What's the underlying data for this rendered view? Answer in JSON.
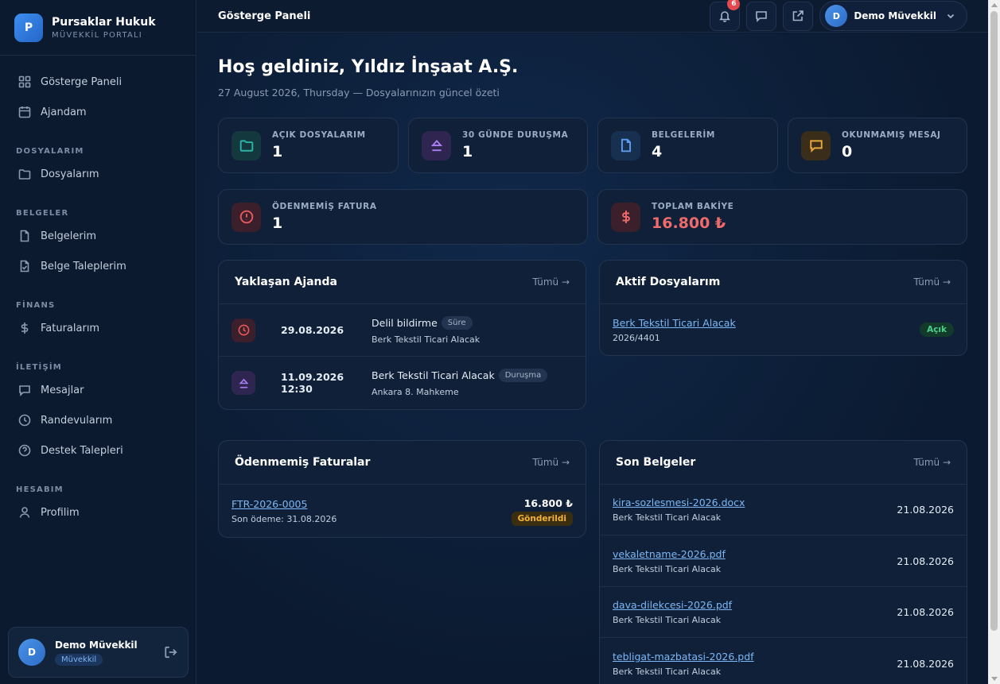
{
  "brand": {
    "logo_letter": "P",
    "name": "Pursaklar Hukuk",
    "subtitle": "MÜVEKKİL PORTALI"
  },
  "sidebar": {
    "items": [
      {
        "label": "Gösterge Paneli",
        "icon": "grid-icon"
      },
      {
        "label": "Ajandam",
        "icon": "calendar-icon"
      }
    ],
    "sections": [
      {
        "title": "DOSYALARIM",
        "items": [
          {
            "label": "Dosyalarım",
            "icon": "folder-icon"
          }
        ]
      },
      {
        "title": "BELGELER",
        "items": [
          {
            "label": "Belgelerim",
            "icon": "file-icon"
          },
          {
            "label": "Belge Taleplerim",
            "icon": "file-check-icon"
          }
        ]
      },
      {
        "title": "FİNANS",
        "items": [
          {
            "label": "Faturalarım",
            "icon": "dollar-icon"
          }
        ]
      },
      {
        "title": "İLETİŞİM",
        "items": [
          {
            "label": "Mesajlar",
            "icon": "message-icon"
          },
          {
            "label": "Randevularım",
            "icon": "clock-icon"
          },
          {
            "label": "Destek Talepleri",
            "icon": "help-icon"
          }
        ]
      },
      {
        "title": "HESABIM",
        "items": [
          {
            "label": "Profilim",
            "icon": "user-icon"
          }
        ]
      }
    ],
    "user": {
      "initial": "D",
      "name": "Demo Müvekkil",
      "role": "Müvekkil"
    }
  },
  "topbar": {
    "title": "Gösterge Paneli",
    "notification_count": "6",
    "user_initial": "D",
    "user_name": "Demo Müvekkil"
  },
  "welcome": {
    "title": "Hoş geldiniz, Yıldız İnşaat A.Ş.",
    "subtitle": "27 August 2026, Thursday — Dosyalarınızın güncel özeti"
  },
  "stats": [
    {
      "label": "AÇIK DOSYALARIM",
      "value": "1",
      "color": "#2bb3a6"
    },
    {
      "label": "30 GÜNDE DURUŞMA",
      "value": "1",
      "color": "#a77ef0"
    },
    {
      "label": "BELGELERİM",
      "value": "4",
      "color": "#5b9cf0"
    },
    {
      "label": "OKUNMAMIŞ MESAJ",
      "value": "0",
      "color": "#e8a93a"
    },
    {
      "label": "ÖDENMEMİŞ FATURA",
      "value": "1",
      "color": "#e55a5a"
    },
    {
      "label": "TOPLAM BAKİYE",
      "value": "16.800 ₺",
      "color": "#ef6b6b"
    }
  ],
  "agenda": {
    "title": "Yaklaşan Ajanda",
    "link": "Tümü →",
    "items": [
      {
        "date": "29.08.2026",
        "title": "Delil bildirme",
        "tag": "Süre",
        "sub": "Berk Tekstil Ticari Alacak"
      },
      {
        "date": "11.09.2026 12:30",
        "title": "Berk Tekstil Ticari Alacak",
        "tag": "Duruşma",
        "sub": "Ankara 8. Mahkeme"
      }
    ]
  },
  "active_files": {
    "title": "Aktif Dosyalarım",
    "link": "Tümü →",
    "items": [
      {
        "name": "Berk Tekstil Ticari Alacak",
        "number": "2026/4401",
        "status": "Açık"
      }
    ]
  },
  "invoices": {
    "title": "Ödenmemiş Faturalar",
    "link": "Tümü →",
    "items": [
      {
        "number": "FTR-2026-0005",
        "due": "Son ödeme: 31.08.2026",
        "amount": "16.800 ₺",
        "status": "Gönderildi"
      }
    ]
  },
  "documents": {
    "title": "Son Belgeler",
    "link": "Tümü →",
    "items": [
      {
        "name": "kira-sozlesmesi-2026.docx",
        "case": "Berk Tekstil Ticari Alacak",
        "date": "21.08.2026"
      },
      {
        "name": "vekaletname-2026.pdf",
        "case": "Berk Tekstil Ticari Alacak",
        "date": "21.08.2026"
      },
      {
        "name": "dava-dilekcesi-2026.pdf",
        "case": "Berk Tekstil Ticari Alacak",
        "date": "21.08.2026"
      },
      {
        "name": "tebligat-mazbatasi-2026.pdf",
        "case": "Berk Tekstil Ticari Alacak",
        "date": "21.08.2026"
      }
    ]
  }
}
